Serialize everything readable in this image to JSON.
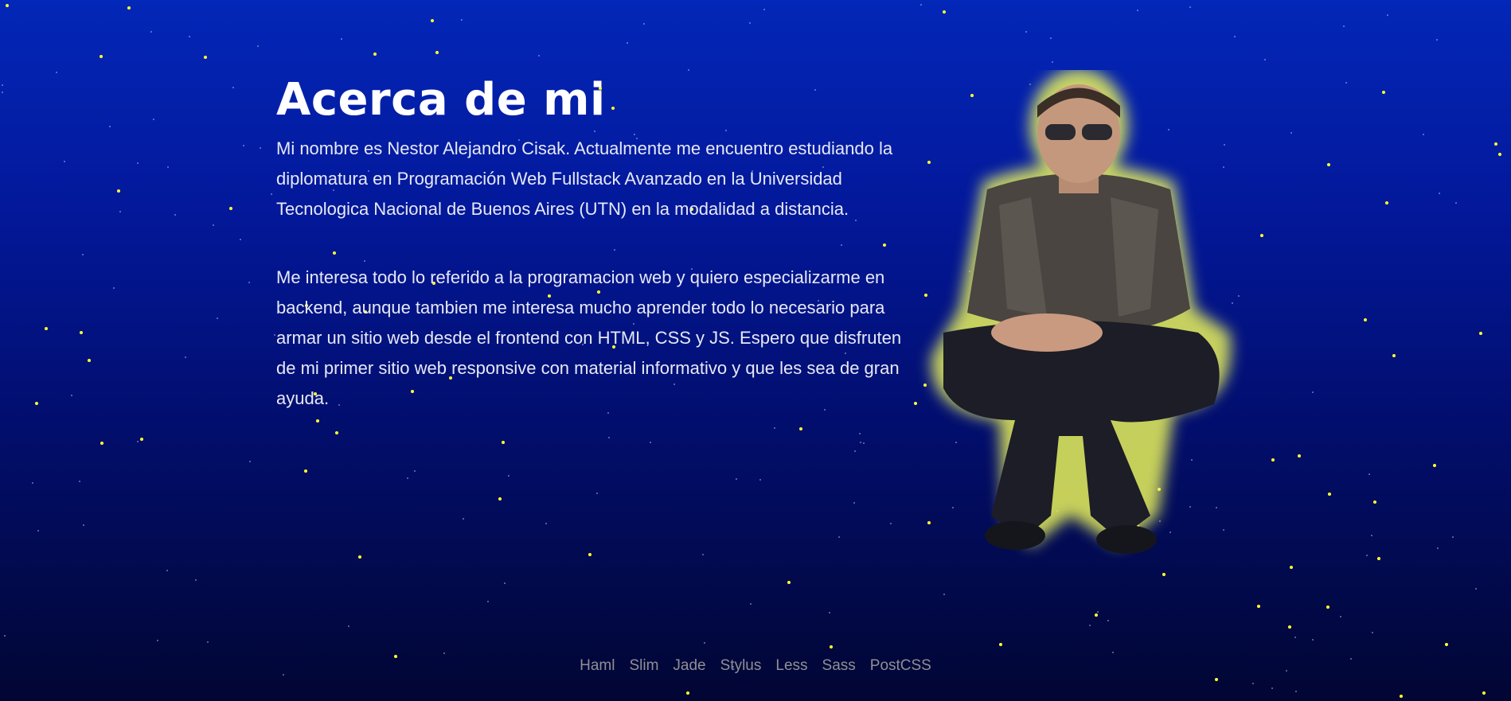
{
  "about": {
    "title": "Acerca de mi",
    "paragraphs": [
      "Mi nombre es Nestor Alejandro Cisak. Actualmente me encuentro estudiando la diplomatura en Programación Web Fullstack Avanzado en la Universidad Tecnologica Nacional de Buenos Aires (UTN) en la modalidad a distancia.",
      "Me interesa todo lo referido a la programacion web y quiero especializarme en backend, aunque tambien me interesa mucho aprender todo lo necesario para armar un sitio web desde el frontend con HTML, CSS y JS. Espero que disfruten de mi primer sitio web responsive con material informativo y que les sea de gran ayuda."
    ]
  },
  "footer": {
    "links": [
      "Haml",
      "Slim",
      "Jade",
      "Stylus",
      "Less",
      "Sass",
      "PostCSS"
    ]
  },
  "colors": {
    "background_top": "#0327b8",
    "background_bottom": "#010633",
    "star": "#ffff2e",
    "photo_glow": "#e8f25a",
    "footer_link": "#8f8f95"
  }
}
